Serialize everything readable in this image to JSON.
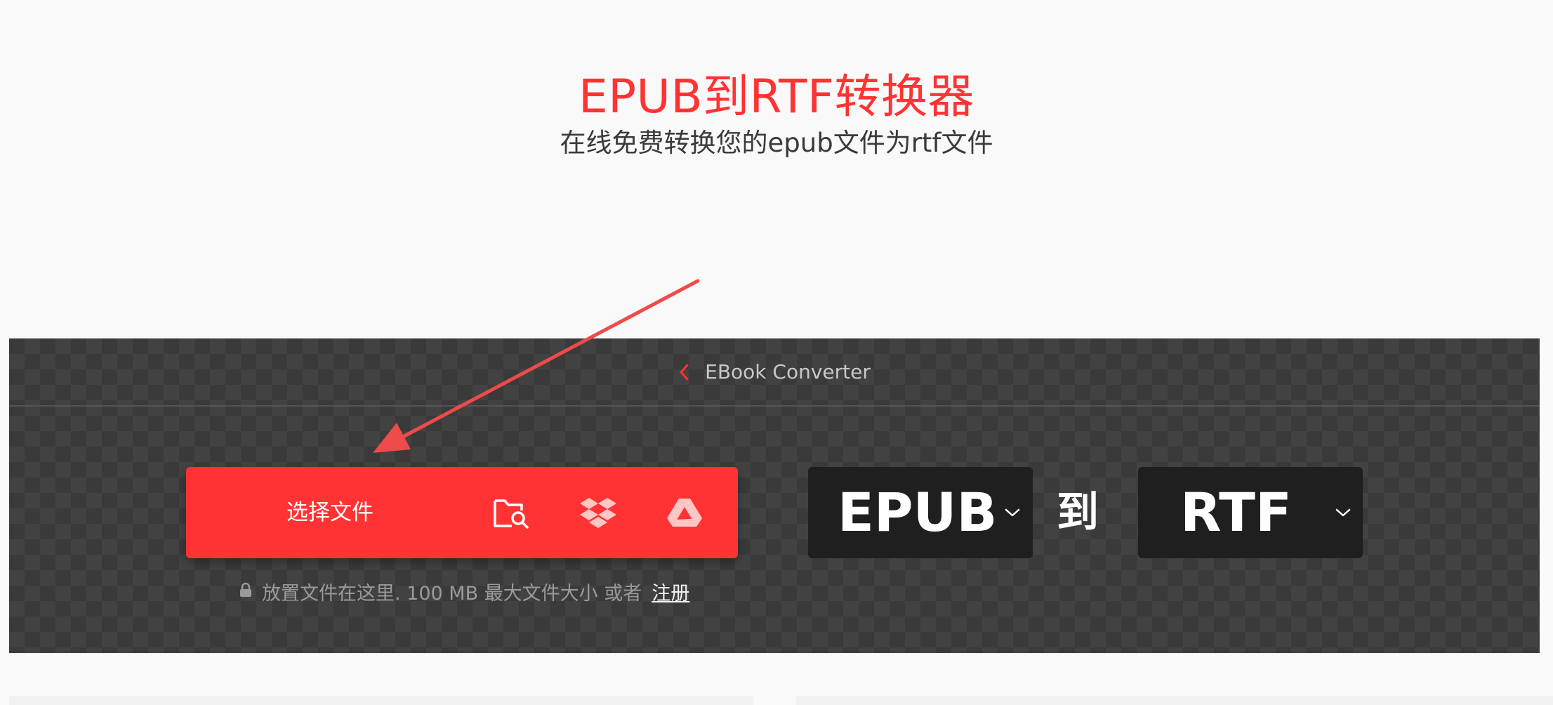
{
  "hero": {
    "title": "EPUB到RTF转换器",
    "subtitle": "在线免费转换您的epub文件为rtf文件"
  },
  "breadcrumb": {
    "label": "EBook Converter",
    "icon": "chevron-left-icon"
  },
  "upload": {
    "choose_label": "选择文件",
    "sources": [
      {
        "name": "device-folder-search-icon"
      },
      {
        "name": "dropbox-icon"
      },
      {
        "name": "google-drive-icon"
      }
    ],
    "hint_icon": "lock-icon",
    "hint_text": "放置文件在这里. 100 MB 最大文件大小 或者",
    "hint_link": "注册"
  },
  "formats": {
    "from": "EPUB",
    "to_word": "到",
    "to": "RTF"
  },
  "colors": {
    "accent": "#ff3333",
    "panel_bg": "#3a3a3a",
    "select_bg": "#1f1f1f",
    "page_bg": "#f9f9fa"
  }
}
